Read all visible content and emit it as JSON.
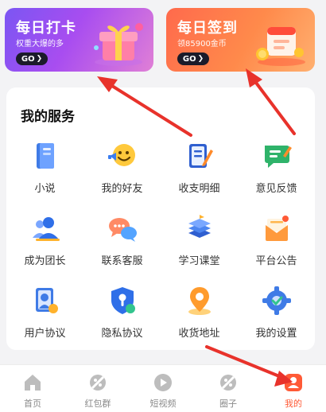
{
  "banners": {
    "daily_card": {
      "title": "每日打卡",
      "subtitle": "权重大爆的多",
      "button": "GO"
    },
    "daily_signin": {
      "title": "每日签到",
      "subtitle": "领85900金币",
      "button": "GO"
    }
  },
  "services": {
    "title": "我的服务",
    "items": [
      {
        "label": "小说",
        "icon": "book-icon"
      },
      {
        "label": "我的好友",
        "icon": "friend-emoji-icon"
      },
      {
        "label": "收支明细",
        "icon": "ledger-icon"
      },
      {
        "label": "意见反馈",
        "icon": "feedback-icon"
      },
      {
        "label": "成为团长",
        "icon": "team-leader-icon"
      },
      {
        "label": "联系客服",
        "icon": "chat-bubbles-icon"
      },
      {
        "label": "学习课堂",
        "icon": "books-stack-icon"
      },
      {
        "label": "平台公告",
        "icon": "announcement-envelope-icon"
      },
      {
        "label": "用户协议",
        "icon": "user-agreement-icon"
      },
      {
        "label": "隐私协议",
        "icon": "privacy-shield-icon"
      },
      {
        "label": "收货地址",
        "icon": "location-pin-icon"
      },
      {
        "label": "我的设置",
        "icon": "settings-gear-icon"
      }
    ]
  },
  "tabbar": {
    "items": [
      {
        "label": "首页",
        "icon": "home-icon",
        "active": false
      },
      {
        "label": "红包群",
        "icon": "red-packet-group-icon",
        "active": false
      },
      {
        "label": "短视频",
        "icon": "play-icon",
        "active": false
      },
      {
        "label": "圈子",
        "icon": "circle-icon",
        "active": false
      },
      {
        "label": "我的",
        "icon": "profile-icon",
        "active": true
      }
    ]
  },
  "colors": {
    "accent": "#ff5a36",
    "arrow": "#e8322b"
  }
}
